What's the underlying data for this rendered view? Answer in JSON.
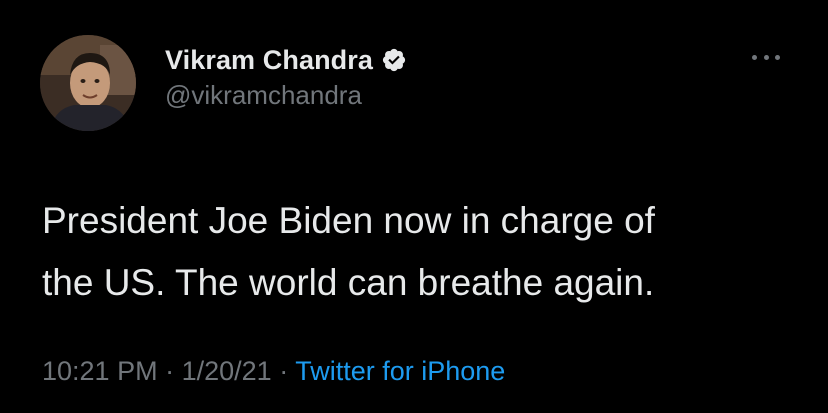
{
  "colors": {
    "background": "#000000",
    "text_primary": "#e7e9ea",
    "text_secondary": "#71767b",
    "accent": "#1d9bf0",
    "verified_badge": "#e7e9ea"
  },
  "author": {
    "display_name": "Vikram Chandra",
    "handle": "@vikramchandra",
    "verified": true,
    "avatar_icon": "profile-photo"
  },
  "tweet": {
    "text_line_1": "President Joe Biden now in charge of",
    "text_line_2": "the US. The world can breathe again.",
    "time": "10:21 PM",
    "separator": "·",
    "date": "1/20/21",
    "source": "Twitter for iPhone"
  },
  "actions": {
    "more_icon": "more-horizontal-icon"
  }
}
